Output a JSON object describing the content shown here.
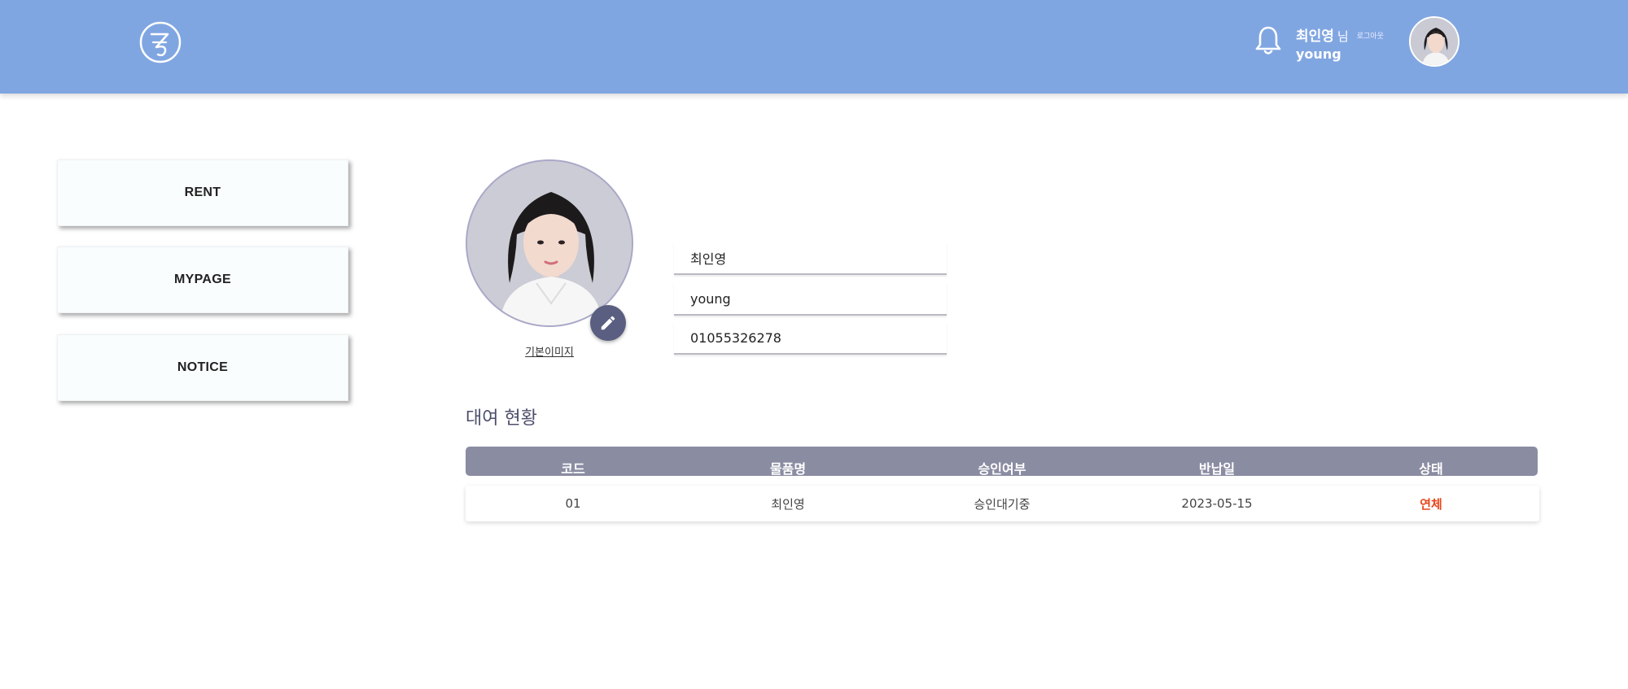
{
  "header": {
    "user_name": "최인영",
    "user_suffix": "님",
    "logout_label": "로그아웃",
    "user_id": "young",
    "bg_color": "#80a6e2"
  },
  "sidebar": {
    "items": [
      {
        "label": "RENT"
      },
      {
        "label": "MYPAGE"
      },
      {
        "label": "NOTICE"
      }
    ]
  },
  "profile": {
    "default_image_link": "기본이미지",
    "name": "최인영",
    "user_id": "young",
    "phone": "01055326278"
  },
  "rental": {
    "title": "대여 현황",
    "columns": [
      "코드",
      "물품명",
      "승인여부",
      "반납일",
      "상태"
    ],
    "rows": [
      {
        "code": "01",
        "item": "최인영",
        "approval": "승인대기중",
        "return_date": "2023-05-15",
        "status": "연체"
      }
    ],
    "status_color": "#e8481b"
  },
  "icons": {
    "logo": "circle-logo-icon",
    "bell": "bell-icon",
    "edit": "pencil-icon"
  }
}
